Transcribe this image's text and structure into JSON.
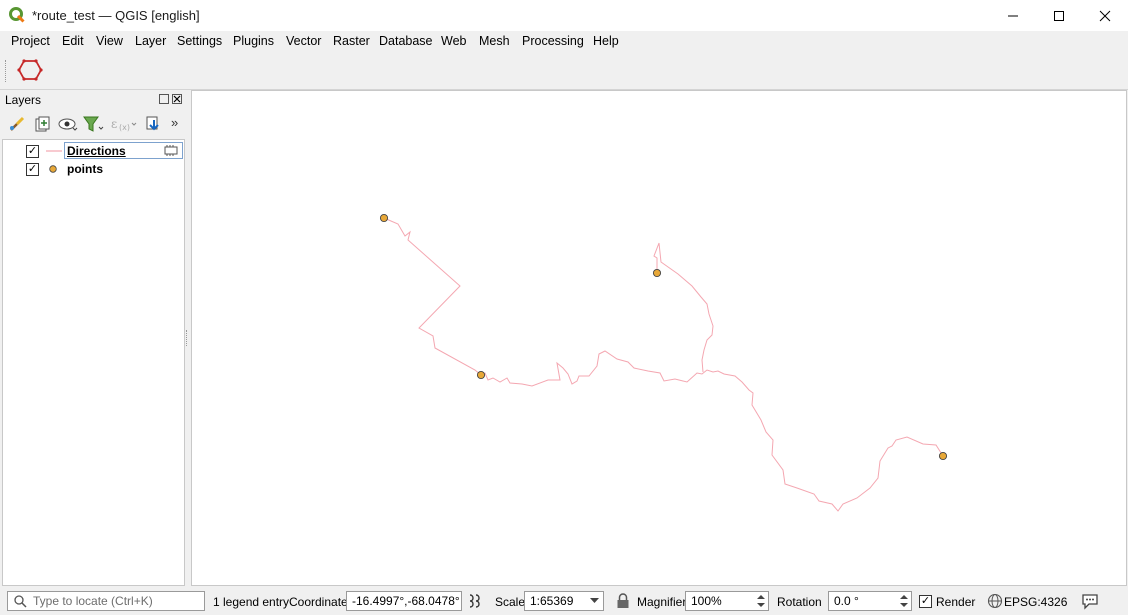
{
  "window": {
    "title": "*route_test — QGIS [english]"
  },
  "menu": [
    "Project",
    "Edit",
    "View",
    "Layer",
    "Settings",
    "Plugins",
    "Vector",
    "Raster",
    "Database",
    "Web",
    "Mesh",
    "Processing",
    "Help"
  ],
  "layers_panel": {
    "title": "Layers",
    "layers": [
      {
        "name": "Directions",
        "checked": true,
        "symbol": "line",
        "color": "#f4a7b1"
      },
      {
        "name": "points",
        "checked": true,
        "symbol": "point",
        "color": "#e8a838"
      }
    ]
  },
  "map": {
    "line_color": "#f4a7b1",
    "point_color": "#e8a838"
  },
  "status": {
    "locate_placeholder": "Type to locate (Ctrl+K)",
    "legend_entries": "1 legend entry",
    "coordinate_label": "Coordinate",
    "coordinate_value": "-16.4997°,-68.0478°",
    "scale_label": "Scale",
    "scale_value": "1:65369",
    "magnifier_label": "Magnifier",
    "magnifier_value": "100%",
    "rotation_label": "Rotation",
    "rotation_value": "0.0 °",
    "render_label": "Render",
    "render_checked": true,
    "crs": "EPSG:4326"
  }
}
